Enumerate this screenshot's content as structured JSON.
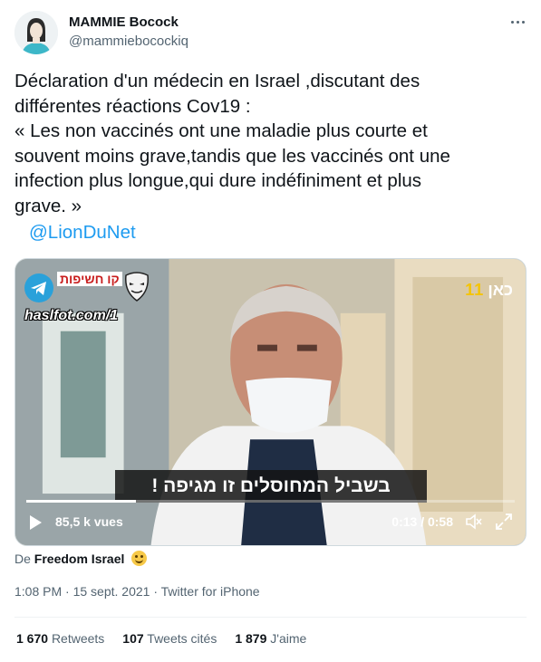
{
  "author": {
    "name": "MAMMIE Bocock",
    "handle": "@mammiebocockiq"
  },
  "tweet": {
    "lines": [
      "Déclaration d'un médecin en Israel ,discutant des",
      "différentes réactions Cov19 :",
      "« Les non vaccinés ont une maladie plus courte et",
      "souvent moins grave,tandis que les vaccinés ont une",
      "infection plus longue,qui dure indéfiniment et plus",
      "grave. »"
    ],
    "mention": "@LionDuNet"
  },
  "video": {
    "watermark_hebrew": "קו חשיפות",
    "watermark_site": "haslfot.com/1",
    "channel_logo_text": "כאן",
    "channel_logo_number": "11",
    "subtitle": "בשביל המחוסלים זו מגיפה !",
    "views": "85,5 k vues",
    "time": "0:13 / 0:58",
    "progress": 0.224
  },
  "source": {
    "prefix": "De",
    "name": "Freedom Israel"
  },
  "meta": {
    "time": "1:08 PM",
    "separator": "·",
    "date": "15 sept. 2021",
    "client": "Twitter for iPhone"
  },
  "stats": {
    "retweets_count": "1 670",
    "retweets_label": "Retweets",
    "quotes_count": "107",
    "quotes_label": "Tweets cités",
    "likes_count": "1 879",
    "likes_label": "J'aime"
  },
  "colors": {
    "accent": "#1d9bf0",
    "secondary_text": "#536471",
    "primary_text": "#0f1419"
  },
  "icons": [
    "more-icon",
    "play-icon",
    "volume-icon",
    "fullscreen-icon",
    "telegram-icon",
    "anonymous-mask-icon",
    "smile-emoji"
  ]
}
